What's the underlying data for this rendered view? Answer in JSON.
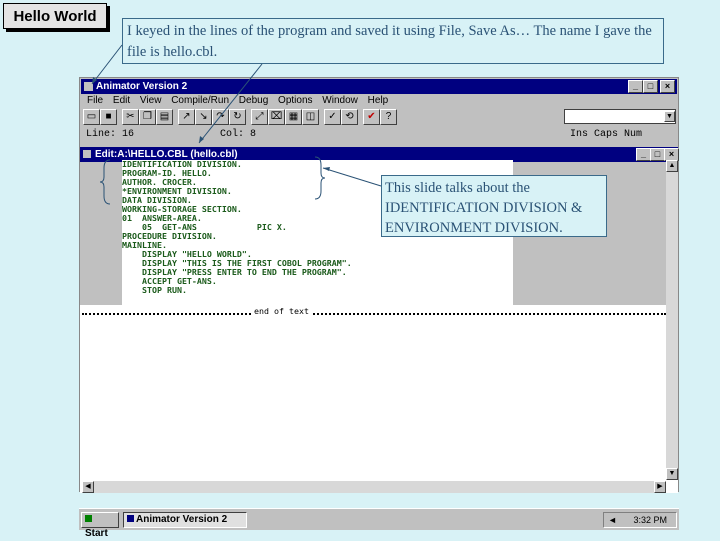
{
  "slide": {
    "title": "Hello World",
    "caption": "I keyed in the lines of the program and saved it using File, Save As… The name I gave the file is hello.cbl.",
    "note": "This slide talks about the IDENTIFICATION DIVISION & ENVIRONMENT DIVISION."
  },
  "app": {
    "title": "Animator Version 2",
    "menu": [
      "File",
      "Edit",
      "View",
      "Compile/Run",
      "Debug",
      "Options",
      "Window",
      "Help"
    ],
    "status": {
      "line": "Line: 16",
      "col": "Col: 8",
      "modes": "Ins Caps Num"
    },
    "window_controls": {
      "min": "_",
      "max": "□",
      "close": "×"
    }
  },
  "editor": {
    "title": "Edit:A:\\HELLO.CBL (hello.cbl)",
    "code_lines": [
      "IDENTIFICATION DIVISION.",
      "PROGRAM-ID. HELLO.",
      "AUTHOR. CROCER.",
      "*ENVIRONMENT DIVISION.",
      "DATA DIVISION.",
      "WORKING-STORAGE SECTION.",
      "01  ANSWER-AREA.",
      "    05  GET-ANS            PIC X.",
      "PROCEDURE DIVISION.",
      "MAINLINE.",
      "    DISPLAY \"HELLO WORLD\".",
      "    DISPLAY \"THIS IS THE FIRST COBOL PROGRAM\".",
      "    DISPLAY \"PRESS ENTER TO END THE PROGRAM\".",
      "    ACCEPT GET-ANS.",
      "    STOP RUN."
    ],
    "end_marker": "end of text"
  },
  "taskbar": {
    "start": "Start",
    "task": "Animator Version 2",
    "clock": "3:32 PM"
  }
}
